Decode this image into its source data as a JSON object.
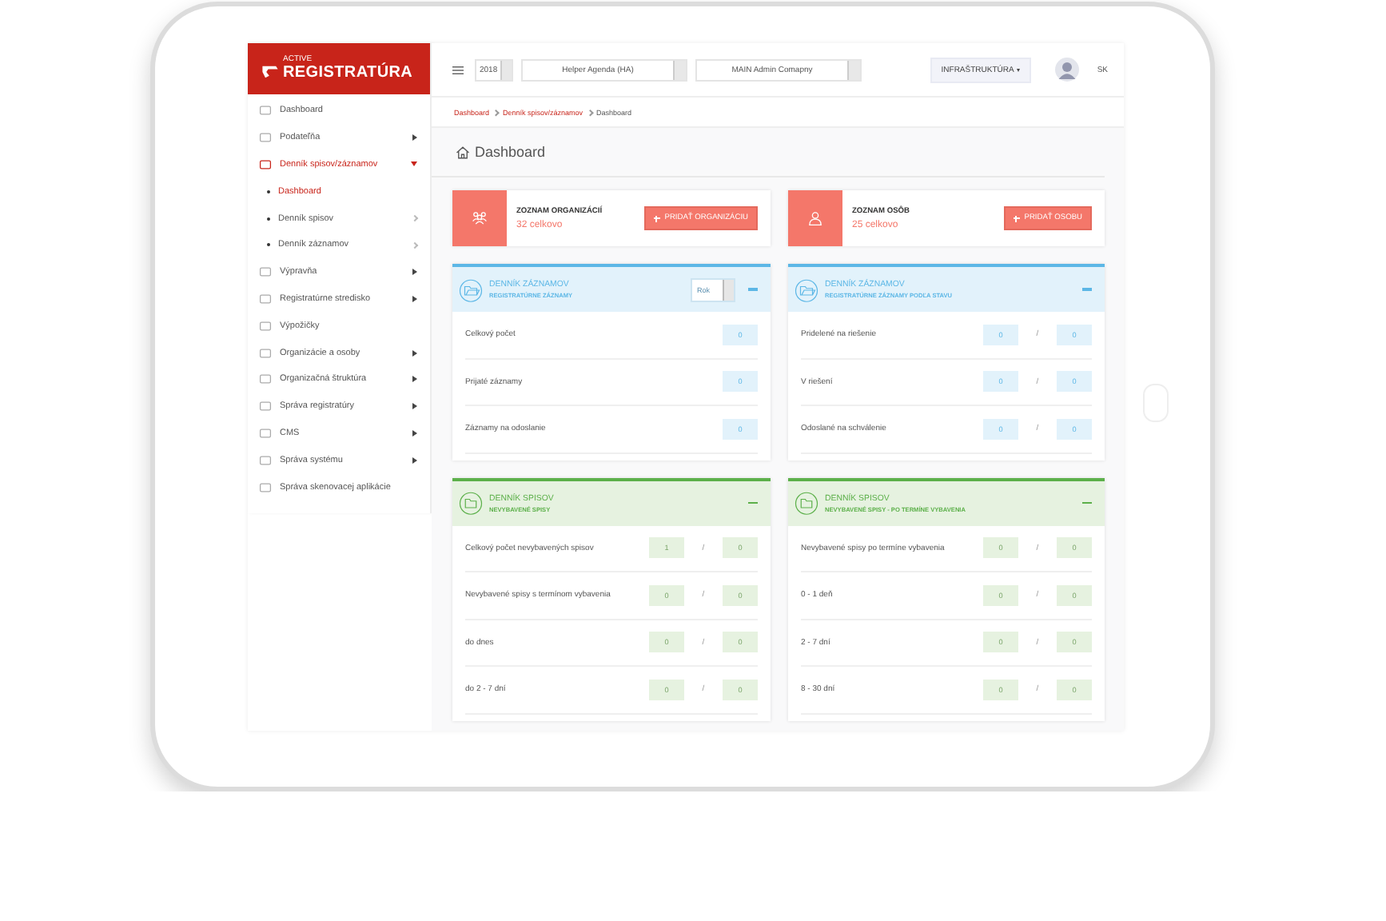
{
  "logo": {
    "small": "ACTIVE",
    "big": "REGISTRATÚRA"
  },
  "sidebar": {
    "items": [
      {
        "label": "Dashboard",
        "selected": false,
        "expanded": false,
        "has_submenu": false
      },
      {
        "label": "Podateľňa",
        "selected": false,
        "expanded": false,
        "has_submenu": true
      },
      {
        "label": "Denník spisov/záznamov",
        "selected": true,
        "expanded": true,
        "has_submenu": true,
        "children": [
          {
            "label": "Dashboard",
            "selected": true,
            "has_submenu": false
          },
          {
            "label": "Denník spisov",
            "selected": false,
            "has_submenu": true
          },
          {
            "label": "Denník záznamov",
            "selected": false,
            "has_submenu": true
          }
        ]
      },
      {
        "label": "Výpravňa",
        "selected": false,
        "expanded": false,
        "has_submenu": true
      },
      {
        "label": "Registratúrne stredisko",
        "selected": false,
        "expanded": false,
        "has_submenu": true
      },
      {
        "label": "Výpožičky",
        "selected": false,
        "expanded": false,
        "has_submenu": false
      },
      {
        "label": "Organizácie a osoby",
        "selected": false,
        "expanded": false,
        "has_submenu": true
      },
      {
        "label": "Organizačná štruktúra",
        "selected": false,
        "expanded": false,
        "has_submenu": true
      },
      {
        "label": "Správa registratúry",
        "selected": false,
        "expanded": false,
        "has_submenu": true
      },
      {
        "label": "CMS",
        "selected": false,
        "expanded": false,
        "has_submenu": true
      },
      {
        "label": "Správa systému",
        "selected": false,
        "expanded": false,
        "has_submenu": true
      },
      {
        "label": "Správa skenovacej aplikácie",
        "selected": false,
        "expanded": false,
        "has_submenu": false
      }
    ]
  },
  "topbar": {
    "selects": [
      {
        "value": "2018",
        "kind": "small"
      },
      {
        "value": "Helper Agenda (HA)",
        "kind": "wide"
      },
      {
        "value": "MAIN Admin Comapny",
        "kind": "wide"
      }
    ],
    "menu_button": "INFRAŠTRUKTÚRA",
    "language": "SK"
  },
  "breadcrumb": [
    {
      "label": "Dashboard",
      "link": true
    },
    {
      "label": "Denník spisov/záznamov",
      "link": true
    },
    {
      "label": "Dashboard",
      "link": false
    }
  ],
  "page_title": "Dashboard",
  "summary_cards": [
    {
      "title": "ZOZNAM ORGANIZÁCIÍ",
      "count": "32 celkovo",
      "button": "PRIDAŤ ORGANIZÁCIU",
      "kind": "group"
    },
    {
      "title": "ZOZNAM OSÔB",
      "count": "25 celkovo",
      "button": "PRIDAŤ OSOBU",
      "kind": "person"
    }
  ],
  "panels": [
    {
      "title": "DENNÍK ZÁZNAMOV",
      "subtitle": "REGISTRATÚRNE ZÁZNAMY",
      "kind": "records",
      "filter": "Rok",
      "rows": [
        {
          "label": "Celkový počet",
          "values": [
            "0"
          ]
        },
        {
          "label": "Prijaté záznamy",
          "values": [
            "0"
          ]
        },
        {
          "label": "Záznamy na odoslanie",
          "values": [
            "0"
          ]
        }
      ]
    },
    {
      "title": "DENNÍK ZÁZNAMOV",
      "subtitle": "REGISTRATÚRNE ZÁZNAMY PODĽA STAVU",
      "kind": "records",
      "rows": [
        {
          "label": "Pridelené na riešenie",
          "values": [
            "0",
            "0"
          ],
          "separator": "/"
        },
        {
          "label": "V riešení",
          "values": [
            "0",
            "0"
          ],
          "separator": "/"
        },
        {
          "label": "Odoslané na schválenie",
          "values": [
            "0",
            "0"
          ],
          "separator": "/"
        }
      ]
    },
    {
      "title": "DENNÍK SPISOV",
      "subtitle": "NEVYBAVENÉ SPISY",
      "kind": "files",
      "rows": [
        {
          "label": "Celkový počet nevybavených spisov",
          "values": [
            "1",
            "0"
          ],
          "separator": "/"
        },
        {
          "label": "Nevybavené spisy s termínom vybavenia",
          "values": [
            "0",
            "0"
          ],
          "separator": "/"
        },
        {
          "label": "do dnes",
          "values": [
            "0",
            "0"
          ],
          "separator": "/"
        },
        {
          "label": "do 2 - 7 dní",
          "values": [
            "0",
            "0"
          ],
          "separator": "/"
        }
      ]
    },
    {
      "title": "DENNÍK SPISOV",
      "subtitle": "NEVYBAVENÉ SPISY - PO TERMÍNE VYBAVENIA",
      "kind": "files",
      "rows": [
        {
          "label": "Nevybavené spisy po termíne vybavenia",
          "values": [
            "0",
            "0"
          ],
          "separator": "/"
        },
        {
          "label": "0 - 1 deň",
          "values": [
            "0",
            "0"
          ],
          "separator": "/"
        },
        {
          "label": "2 - 7 dní",
          "values": [
            "0",
            "0"
          ],
          "separator": "/"
        },
        {
          "label": "8 - 30 dní",
          "values": [
            "0",
            "0"
          ],
          "separator": "/"
        }
      ]
    }
  ]
}
